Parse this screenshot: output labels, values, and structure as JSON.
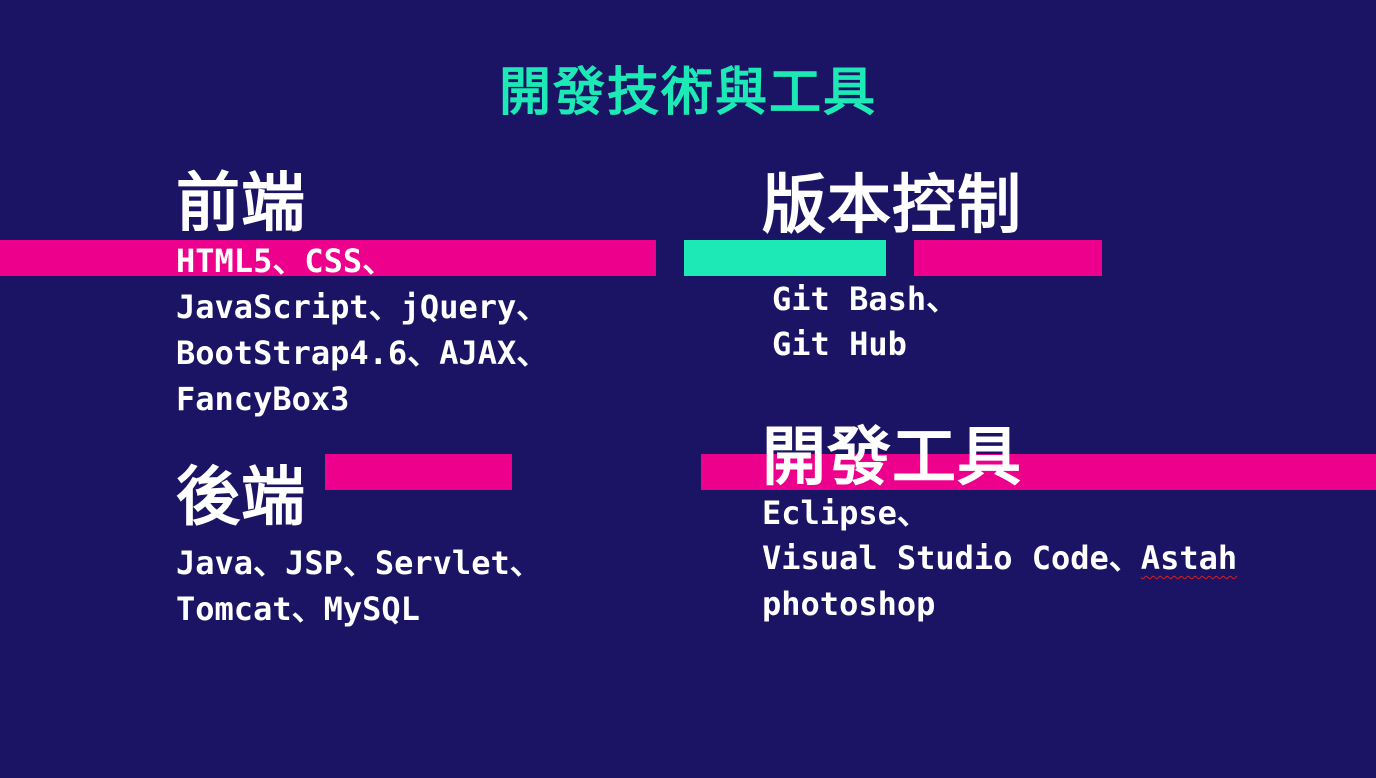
{
  "title": "開發技術與工具",
  "frontend": {
    "heading": "前端",
    "lines": [
      "HTML5、CSS、",
      "JavaScript、jQuery、",
      "BootStrap4.6、AJAX、",
      "FancyBox3"
    ]
  },
  "backend": {
    "heading": "後端",
    "lines": [
      "Java、JSP、Servlet、",
      "Tomcat、MySQL"
    ]
  },
  "version_control": {
    "heading": "版本控制",
    "lines": [
      "Git Bash、",
      "Git Hub"
    ]
  },
  "dev_tools": {
    "heading": "開發工具",
    "line1": "Eclipse、",
    "line2_prefix": "Visual Studio Code、",
    "line2_marked": "Astah",
    "line3": "photoshop"
  },
  "colors": {
    "background": "#1b1464",
    "accent_mint": "#1de9b6",
    "accent_pink": "#ec008c",
    "text": "#ffffff"
  }
}
